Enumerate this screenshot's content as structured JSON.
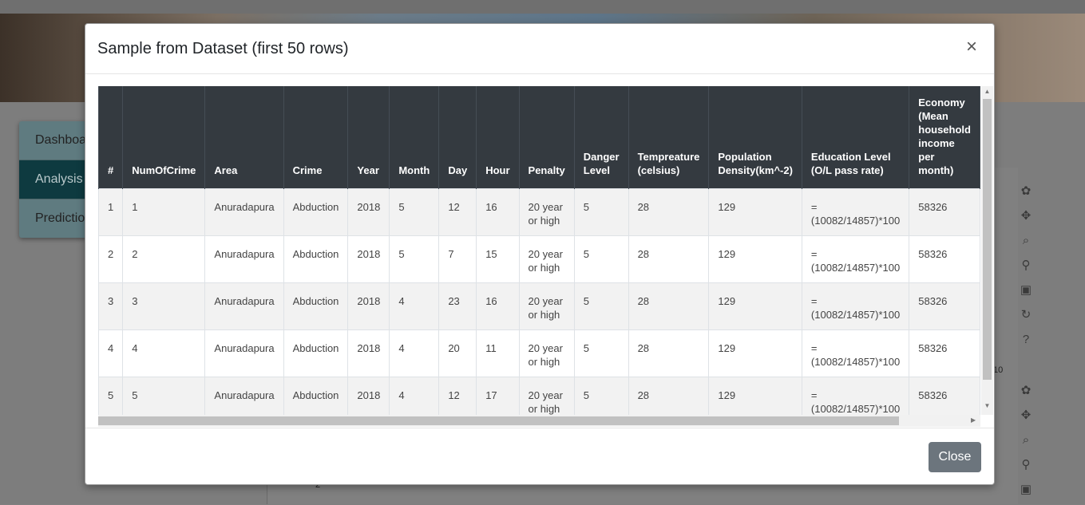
{
  "background": {
    "sidebar": [
      {
        "label": "Dashboa",
        "active": false
      },
      {
        "label": "Analysis",
        "active": true
      },
      {
        "label": "Predictio",
        "active": false
      }
    ],
    "plot_tick_label": "10",
    "plot_tick_label_2": "2"
  },
  "modal": {
    "title": "Sample from Dataset (first 50 rows)",
    "close_x": "×",
    "close_button": "Close",
    "columns": [
      "#",
      "NumOfCrime",
      "Area",
      "Crime",
      "Year",
      "Month",
      "Day",
      "Hour",
      "Penalty",
      "Danger Level",
      "Tempreature (celsius)",
      "Population Density(km^-2)",
      "Education Level (O/L pass rate)",
      "Economy (Mean household income per month)"
    ],
    "rows": [
      [
        "1",
        "1",
        "Anuradapura",
        "Abduction",
        "2018",
        "5",
        "12",
        "16",
        "20 year or high",
        "5",
        "28",
        "129",
        "=(10082/14857)*100",
        "58326"
      ],
      [
        "2",
        "2",
        "Anuradapura",
        "Abduction",
        "2018",
        "5",
        "7",
        "15",
        "20 year or high",
        "5",
        "28",
        "129",
        "=(10082/14857)*100",
        "58326"
      ],
      [
        "3",
        "3",
        "Anuradapura",
        "Abduction",
        "2018",
        "4",
        "23",
        "16",
        "20 year or high",
        "5",
        "28",
        "129",
        "=(10082/14857)*100",
        "58326"
      ],
      [
        "4",
        "4",
        "Anuradapura",
        "Abduction",
        "2018",
        "4",
        "20",
        "11",
        "20 year or high",
        "5",
        "28",
        "129",
        "=(10082/14857)*100",
        "58326"
      ],
      [
        "5",
        "5",
        "Anuradapura",
        "Abduction",
        "2018",
        "4",
        "12",
        "17",
        "20 year or high",
        "5",
        "28",
        "129",
        "=(10082/14857)*100",
        "58326"
      ]
    ]
  }
}
